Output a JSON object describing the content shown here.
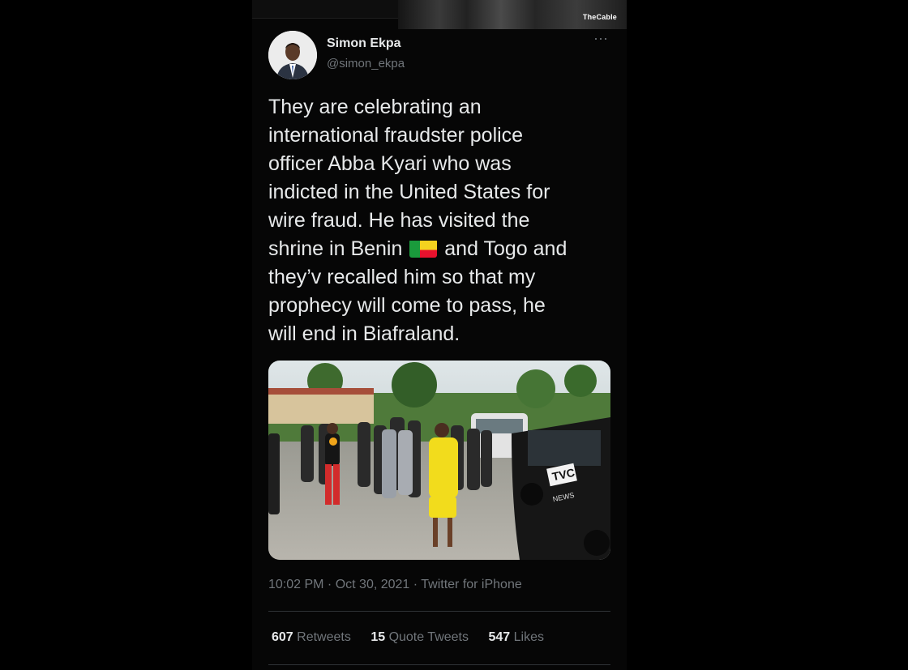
{
  "watermark": "TheCable",
  "tweet": {
    "author_name": "Simon Ekpa",
    "author_handle": "@simon_ekpa",
    "more_label": "···",
    "text_part1": "They are celebrating an\ninternational fraudster police\nofficer Abba Kyari who was\nindicted in the United States for\nwire fraud. He has visited the\nshrine in Benin ",
    "text_part2": " and Togo and\nthey’v recalled him so that my\nprophecy will come to pass, he\nwill end in Biafraland.",
    "flag_colors": {
      "green": "#1a9b3c",
      "yellow": "#f4d21f",
      "red": "#e8112d"
    },
    "photo_van_text": "TVC",
    "photo_van_subtext": "NEWS",
    "timestamp": "10:02 PM · Oct 30, 2021 · Twitter for iPhone",
    "stats": {
      "retweets_count": "607",
      "retweets_label": "Retweets",
      "quotes_count": "15",
      "quotes_label": "Quote Tweets",
      "likes_count": "547",
      "likes_label": "Likes"
    }
  },
  "colors": {
    "background": "#000000",
    "text_primary": "#e7e9ea",
    "text_secondary": "#71767b",
    "divider": "#2f3336"
  }
}
